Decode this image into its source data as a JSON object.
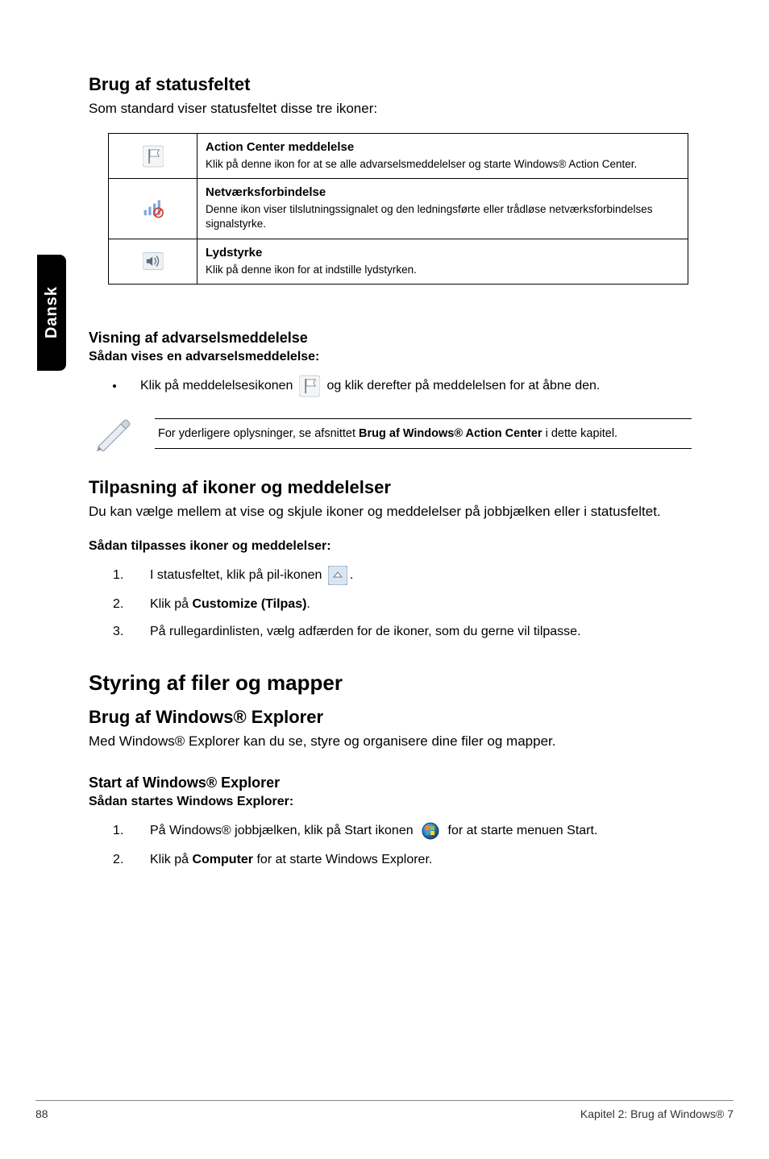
{
  "sideTab": "Dansk",
  "s1": {
    "title": "Brug af statusfeltet",
    "lead": "Som standard viser statusfeltet disse tre ikoner:",
    "rows": [
      {
        "title": "Action Center meddelelse",
        "desc": "Klik på denne ikon for at se alle advarselsmeddelelser og starte Windows® Action Center."
      },
      {
        "title": "Netværksforbindelse",
        "desc": "Denne ikon viser tilslutningssignalet og den ledningsførte eller trådløse netværksforbindelses signalstyrke."
      },
      {
        "title": "Lydstyrke",
        "desc": "Klik på denne ikon for at indstille lydstyrken."
      }
    ]
  },
  "s2": {
    "title": "Visning af advarselsmeddelelse",
    "subtitle": "Sådan vises en advarselsmeddelelse:",
    "bullet_a": "Klik på meddelelsesikonen",
    "bullet_b": "og klik derefter på meddelelsen for at åbne den.",
    "note_a": "For yderligere oplysninger, se afsnittet ",
    "note_bold": "Brug af Windows® Action Center",
    "note_b": " i dette kapitel."
  },
  "s3": {
    "title": "Tilpasning af ikoner og meddelelser",
    "lead": "Du kan vælge mellem at vise og skjule ikoner og meddelelser på jobbjælken eller i statusfeltet.",
    "subtitle": "Sådan tilpasses ikoner og meddelelser:",
    "step1": "I statusfeltet, klik på pil-ikonen",
    "step1_end": ".",
    "step2_a": "Klik på ",
    "step2_bold": "Customize (Tilpas)",
    "step2_b": ".",
    "step3": "På rullegardinlisten, vælg adfærden for de ikoner, som du gerne vil tilpasse."
  },
  "s4": {
    "big": "Styring af filer og mapper",
    "title": "Brug af Windows® Explorer",
    "lead": "Med Windows® Explorer kan du se, styre og organisere dine filer og mapper.",
    "sub": "Start af Windows® Explorer",
    "subsub": "Sådan startes Windows Explorer:",
    "step1_a": "På Windows® jobbjælken, klik på Start ikonen",
    "step1_b": "for at starte menuen Start.",
    "step2_a": "Klik på ",
    "step2_bold": "Computer",
    "step2_b": " for at starte Windows Explorer."
  },
  "footer": {
    "page": "88",
    "chapter": "Kapitel 2: Brug af Windows® 7"
  }
}
